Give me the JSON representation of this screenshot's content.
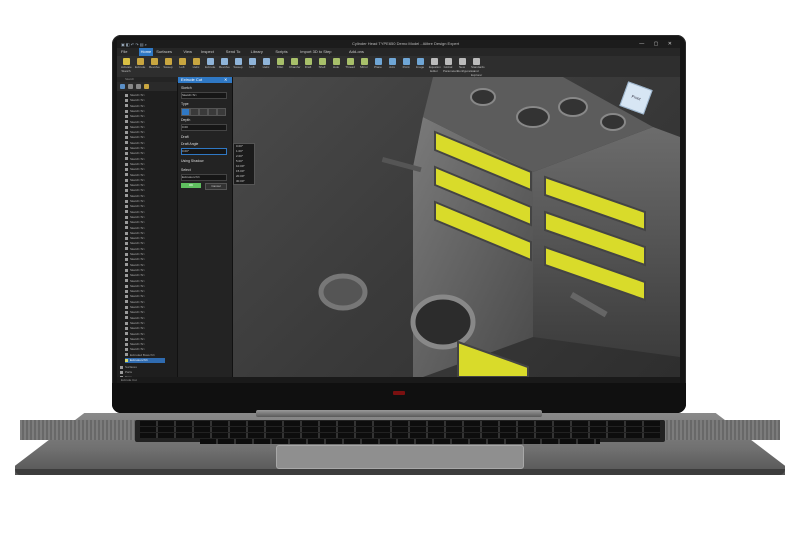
{
  "window": {
    "title": "Cylinder Head TYPE650 Demo Model - Alibre Design Expert",
    "controls": [
      "—",
      "▢",
      "✕"
    ]
  },
  "menus": [
    {
      "label": "File",
      "selected": false
    },
    {
      "label": "Home",
      "selected": true
    },
    {
      "label": "Surfaces",
      "selected": false
    },
    {
      "label": "View",
      "selected": false
    },
    {
      "label": "Inspect",
      "selected": false
    },
    {
      "label": "Send To",
      "selected": false
    },
    {
      "label": "Library",
      "selected": false
    },
    {
      "label": "Scripts",
      "selected": false
    },
    {
      "label": "Import 3D to Step",
      "selected": false
    },
    {
      "label": "Add-ons",
      "selected": false
    }
  ],
  "ribbon": {
    "buttons": [
      {
        "label": "Activate Sketch",
        "icon": "sketch-icon",
        "color": "#d9c043"
      },
      {
        "label": "Extrude",
        "icon": "extrude-icon",
        "color": "#c9a640"
      },
      {
        "label": "Revolve",
        "icon": "revolve-icon",
        "color": "#c9a640"
      },
      {
        "label": "Sweep",
        "icon": "sweep-icon",
        "color": "#c9a640"
      },
      {
        "label": "Loft",
        "icon": "loft-icon",
        "color": "#c9a640"
      },
      {
        "label": "Helix",
        "icon": "helix-icon",
        "color": "#c9a640"
      },
      {
        "label": "Extrude",
        "icon": "extrude-cut-icon",
        "color": "#8fb4d9"
      },
      {
        "label": "Revolve",
        "icon": "revolve-cut-icon",
        "color": "#8fb4d9"
      },
      {
        "label": "Sweep",
        "icon": "sweep-cut-icon",
        "color": "#8fb4d9"
      },
      {
        "label": "Loft",
        "icon": "loft-cut-icon",
        "color": "#8fb4d9"
      },
      {
        "label": "Helix",
        "icon": "helix-cut-icon",
        "color": "#8fb4d9"
      },
      {
        "label": "Fillet",
        "icon": "fillet-icon",
        "color": "#a8c06a"
      },
      {
        "label": "Chamfer",
        "icon": "chamfer-icon",
        "color": "#a8c06a"
      },
      {
        "label": "Draft",
        "icon": "draft-icon",
        "color": "#a8c06a"
      },
      {
        "label": "Shell",
        "icon": "shell-icon",
        "color": "#a8c06a"
      },
      {
        "label": "Hole",
        "icon": "hole-icon",
        "color": "#a8c06a"
      },
      {
        "label": "Thread",
        "icon": "thread-icon",
        "color": "#a8c06a"
      },
      {
        "label": "Mirror",
        "icon": "mirror-icon",
        "color": "#a8c06a"
      },
      {
        "label": "Plane",
        "icon": "plane-icon",
        "color": "#6fa6d6"
      },
      {
        "label": "Axis",
        "icon": "axis-icon",
        "color": "#6fa6d6"
      },
      {
        "label": "Point",
        "icon": "point-icon",
        "color": "#6fa6d6"
      },
      {
        "label": "Image",
        "icon": "image-icon",
        "color": "#6fa6d6"
      },
      {
        "label": "Equation Editor",
        "icon": "equation-icon",
        "color": "#bbbbbb"
      },
      {
        "label": "Global Parameters",
        "icon": "parameters-icon",
        "color": "#bbbbbb"
      },
      {
        "label": "New Configuration",
        "icon": "configuration-icon",
        "color": "#bbbbbb"
      },
      {
        "label": "Standards and Explorer",
        "icon": "standards-icon",
        "color": "#bbbbbb"
      }
    ],
    "patterns": [
      "Linear Pattern",
      "Circular Pattern",
      "Sort Pattern"
    ],
    "scale": [
      "Scale / Move Face",
      "Move Face",
      "Simplify Face"
    ]
  },
  "group_labels": [
    "Sketch",
    "Features",
    "Part Tools",
    "Reference",
    "Feature Tools"
  ],
  "tree": {
    "items": [
      "Sketch<N>",
      "Sketch<N>",
      "Sketch<N>",
      "Sketch<N>",
      "Sketch<N>",
      "Sketch<N>",
      "Sketch<N>",
      "Sketch<N>",
      "Sketch<N>",
      "Sketch<N>",
      "Sketch<N>",
      "Sketch<N>",
      "Sketch<N>",
      "Sketch<N>",
      "Sketch<N>",
      "Sketch<N>",
      "Sketch<N>",
      "Sketch<N>",
      "Sketch<N>",
      "Sketch<N>",
      "Sketch<N>",
      "Sketch<N>",
      "Sketch<N>",
      "Sketch<N>",
      "Sketch<N>",
      "Sketch<N>",
      "Sketch<N>",
      "Sketch<N>",
      "Sketch<N>",
      "Sketch<N>",
      "Sketch<N>",
      "Sketch<N>",
      "Sketch<N>",
      "Sketch<N>",
      "Sketch<N>",
      "Sketch<N>",
      "Sketch<N>",
      "Sketch<N>",
      "Sketch<N>",
      "Sketch<N>",
      "Sketch<N>",
      "Sketch<N>",
      "Sketch<N>",
      "Sketch<N>",
      "Sketch<N>",
      "Sketch<N>",
      "Sketch<N>",
      "Sketch<N>",
      "Sketch<N>",
      "Extruded Boss<N>",
      "Extrusion<N>"
    ],
    "selected": "Sketch<N>",
    "footer": [
      "Surfaces",
      "Parts",
      "Dims"
    ]
  },
  "panel": {
    "title": "Extrude Cut",
    "sketch_label": "Sketch",
    "sketch_value": "Sketch<N>",
    "type_label": "Type",
    "depth_label": "Depth",
    "depth_value": "0.00",
    "draft_label": "Draft",
    "draft_angle_label": "Draft Angle",
    "draft_angle_value": "0.00°",
    "thin_label": "Using Shadow",
    "select_label": "Select",
    "select_value": "Extrusion<N>",
    "ok_label": "OK",
    "cancel_label": "Cancel",
    "dropdown_options": [
      "0.00°",
      "1.00°",
      "2.00°",
      "5.00°",
      "10.00°",
      "15.00°",
      "20.00°",
      "30.00°"
    ]
  },
  "viewcube": {
    "label": "Front",
    "color": "#d7e6f4"
  },
  "status": {
    "text": "Extrude Cut"
  },
  "colors": {
    "accent": "#2f78c4",
    "highlight": "#d9db2a",
    "ok": "#5fbf5f"
  }
}
